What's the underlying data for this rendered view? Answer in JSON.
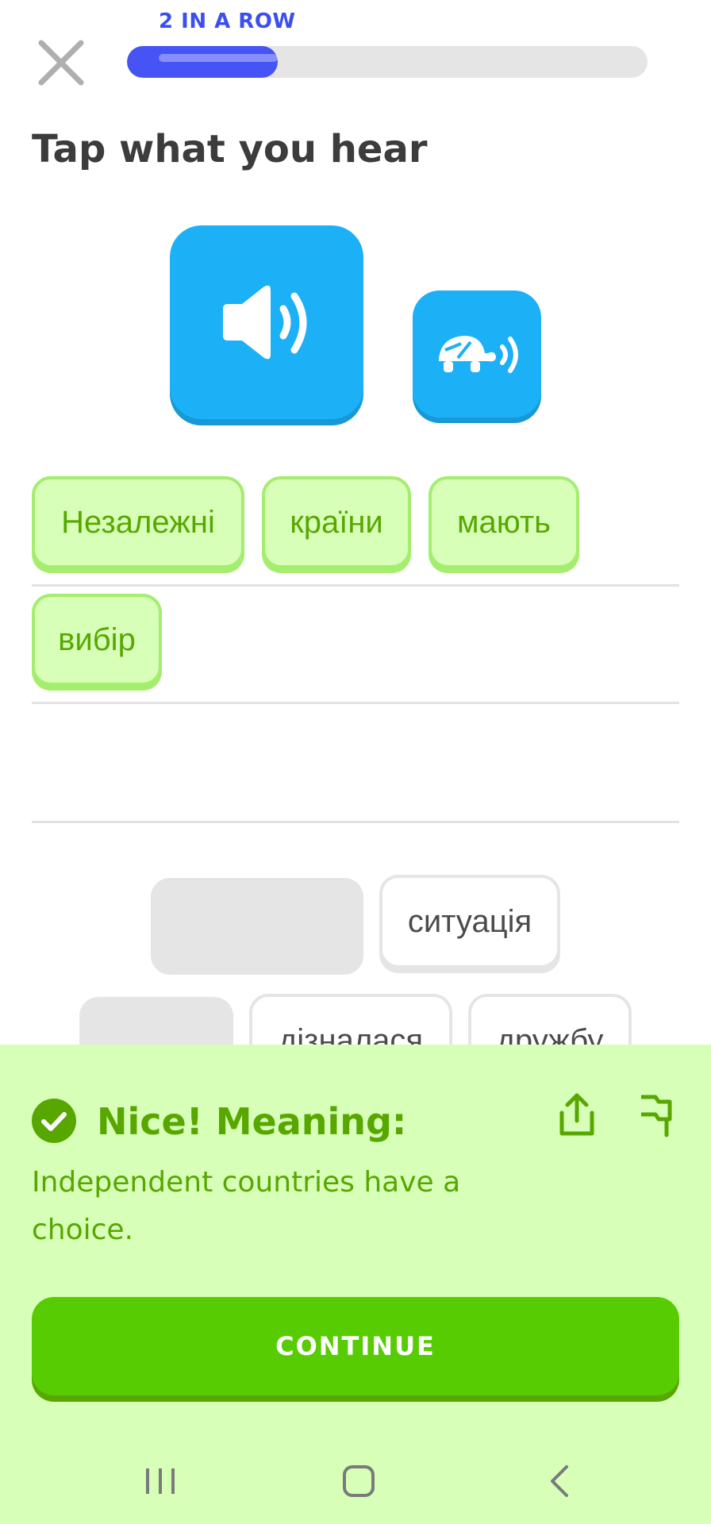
{
  "header": {
    "streak_label": "2 IN A ROW",
    "progress_fraction": 0.29
  },
  "prompt": "Tap what you hear",
  "icons": {
    "close": "close-icon",
    "speaker": "speaker-icon",
    "slow": "turtle-speaker-icon",
    "check": "check-circle-icon",
    "share": "share-icon",
    "flag": "flag-icon"
  },
  "answer": {
    "words": [
      "Незалежні",
      "країни",
      "мають",
      "вибір"
    ]
  },
  "bank": {
    "row1": [
      "ситуація"
    ],
    "row2": [
      "дізналася",
      "дружбу"
    ]
  },
  "feedback": {
    "title": "Nice! Meaning:",
    "meaning": "Independent countries have a choice.",
    "continue_label": "CONTINUE"
  },
  "colors": {
    "accent_blue": "#1cb0f6",
    "progress": "#4653f5",
    "success": "#58cc02",
    "success_text": "#58a700",
    "panel_bg": "#d7ffb8"
  }
}
